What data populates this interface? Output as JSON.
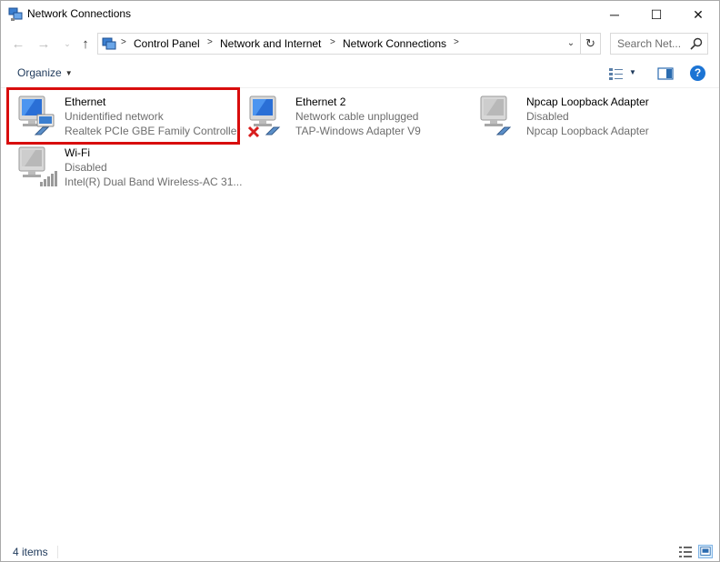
{
  "window": {
    "title": "Network Connections",
    "controls": {
      "minimize": "─",
      "maximize": "☐",
      "close": "✕"
    }
  },
  "navigation": {
    "back_icon": "arrow-left-icon",
    "forward_icon": "arrow-right-icon",
    "recent_icon": "chevron-down-icon",
    "up_icon": "arrow-up-icon",
    "glyphs": {
      "back": "←",
      "forward": "→",
      "recent": "⌄",
      "up": "↑",
      "refresh": "↻",
      "dropdown": "⌄"
    }
  },
  "address": {
    "breadcrumbs": [
      "Control Panel",
      "Network and Internet",
      "Network Connections"
    ],
    "separator": ">"
  },
  "search": {
    "placeholder": "Search Net..."
  },
  "toolbar": {
    "organize_label": "Organize",
    "caret": "▼",
    "help_label": "?"
  },
  "items": [
    {
      "name": "Ethernet",
      "status": "Unidentified network",
      "device": "Realtek PCIe GBE Family Controller",
      "icon": "ethernet-adapter-icon",
      "selected_highlight": true
    },
    {
      "name": "Ethernet 2",
      "status": "Network cable unplugged",
      "device": "TAP-Windows Adapter V9",
      "icon": "ethernet-adapter-unplugged-icon"
    },
    {
      "name": "Npcap Loopback Adapter",
      "status": "Disabled",
      "device": "Npcap Loopback Adapter",
      "icon": "ethernet-adapter-disabled-icon"
    },
    {
      "name": "Wi-Fi",
      "status": "Disabled",
      "device": "Intel(R) Dual Band Wireless-AC 31...",
      "icon": "wifi-adapter-disabled-icon"
    }
  ],
  "status_bar": {
    "count_text": "4 items"
  },
  "colors": {
    "highlight_border": "#d80d0d",
    "help_blue": "#1c74d4",
    "subtext": "#6d6d6d",
    "link_blue": "#1e395b"
  }
}
